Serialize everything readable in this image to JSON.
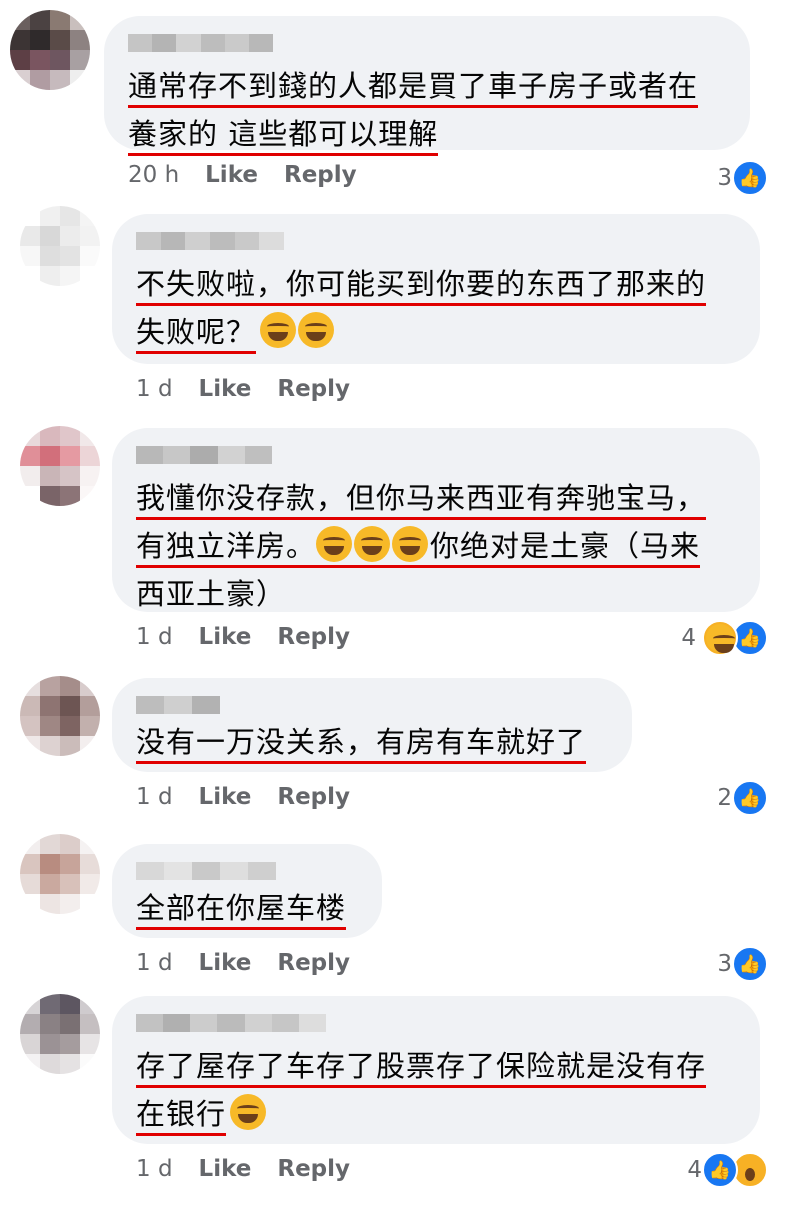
{
  "comments": [
    {
      "lines": [
        "通常存不到錢的人都是買了車子房子或者在",
        "養家的 這些都可以理解"
      ],
      "time": "20 h",
      "like": "Like",
      "reply": "Reply",
      "count": "3",
      "reactions": [
        "like-icon"
      ]
    },
    {
      "lines": [
        "不失败啦，你可能买到你要的东西了那来的",
        "失败呢？"
      ],
      "emojis": [
        0,
        2
      ],
      "time": "1 d",
      "like": "Like",
      "reply": "Reply",
      "count": "",
      "reactions": []
    },
    {
      "lines": [
        "我懂你没存款，但你马来西亚有奔驰宝马，",
        "有独立洋房。",
        "你绝对是土豪（马来",
        "西亚土豪）"
      ],
      "time": "1 d",
      "like": "Like",
      "reply": "Reply",
      "count": "4",
      "reactions": [
        "haha-icon",
        "like-icon"
      ]
    },
    {
      "lines": [
        "没有一万没关系，有房有车就好了"
      ],
      "time": "1 d",
      "like": "Like",
      "reply": "Reply",
      "count": "2",
      "reactions": [
        "like-icon"
      ]
    },
    {
      "lines": [
        "全部在你屋车楼"
      ],
      "time": "1 d",
      "like": "Like",
      "reply": "Reply",
      "count": "3",
      "reactions": [
        "like-icon"
      ]
    },
    {
      "lines": [
        "存了屋存了车存了股票存了保险就是没有存",
        "在银行"
      ],
      "time": "1 d",
      "like": "Like",
      "reply": "Reply",
      "count": "4",
      "reactions": [
        "like-icon",
        "wow-icon"
      ]
    }
  ],
  "colors": {
    "bubble": "#f0f2f5",
    "underline": "#e00000",
    "like_blue": "#1877f2",
    "meta_gray": "#65676b"
  }
}
